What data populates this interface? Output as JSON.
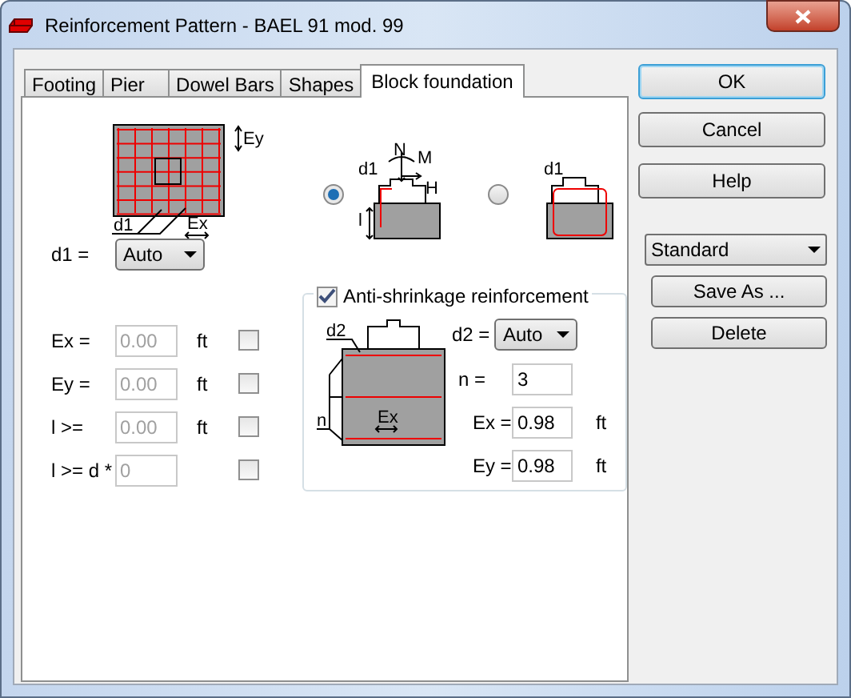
{
  "window": {
    "title": "Reinforcement Pattern - BAEL 91 mod. 99"
  },
  "tabs": [
    {
      "label": "Footing",
      "selected": false
    },
    {
      "label": "Pier",
      "selected": false
    },
    {
      "label": "Dowel Bars",
      "selected": false
    },
    {
      "label": "Shapes",
      "selected": false
    },
    {
      "label": "Block foundation",
      "selected": true
    }
  ],
  "plan_diagram": {
    "labels": [
      "Ey",
      "d1",
      "Ex"
    ]
  },
  "layouts": [
    {
      "selected": true,
      "labels": [
        "N",
        "M",
        "d1",
        "H",
        "l"
      ]
    },
    {
      "selected": false,
      "labels": [
        "d1"
      ]
    }
  ],
  "fields": [
    {
      "kind": "dropdown",
      "label": "d1 =",
      "value": "Auto"
    },
    {
      "kind": "input",
      "label": "Ex =",
      "value": "0.00",
      "unit": "ft",
      "disabled": true,
      "checked": false
    },
    {
      "kind": "input",
      "label": "Ey =",
      "value": "0.00",
      "unit": "ft",
      "disabled": true,
      "checked": false
    },
    {
      "kind": "input",
      "label": "l >=",
      "value": "0.00",
      "unit": "ft",
      "disabled": true,
      "checked": false
    },
    {
      "kind": "input",
      "label": "l >= d *",
      "value": "0",
      "disabled": true,
      "checked": false
    }
  ],
  "anti_shrinkage": {
    "label": "Anti-shrinkage reinforcement",
    "checked": true,
    "diagram_labels": [
      "d2",
      "n",
      "Ex"
    ],
    "d2": {
      "label": "d2 =",
      "value": "Auto"
    },
    "fields": [
      {
        "label": "n =",
        "value": "3"
      },
      {
        "label": "Ex =",
        "value": "0.98",
        "unit": "ft"
      },
      {
        "label": "Ey =",
        "value": "0.98",
        "unit": "ft"
      }
    ]
  },
  "buttons": [
    {
      "label": "OK",
      "default": true
    },
    {
      "label": "Cancel",
      "default": false
    },
    {
      "label": "Help",
      "default": false
    }
  ],
  "preset": {
    "value": "Standard"
  },
  "preset_buttons": [
    "Save As ...",
    "Delete"
  ]
}
